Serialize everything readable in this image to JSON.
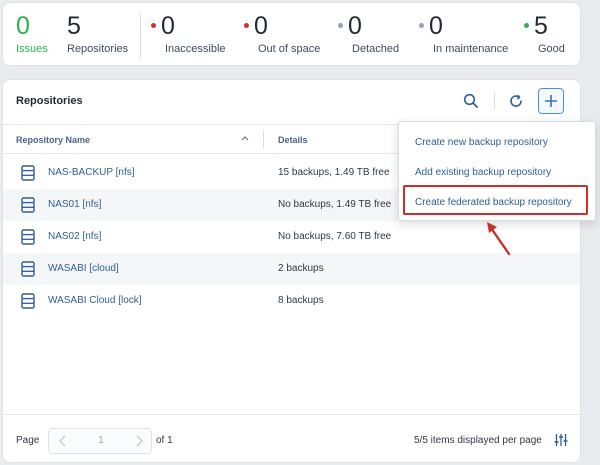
{
  "summary": {
    "issues": {
      "value": "0",
      "label": "Issues",
      "color": "#2bb24c"
    },
    "repositories": {
      "value": "5",
      "label": "Repositories"
    },
    "inaccessible": {
      "value": "0",
      "label": "Inaccessible",
      "dot_color": "#d32f2f"
    },
    "out_of_space": {
      "value": "0",
      "label": "Out of space",
      "dot_color": "#d32f2f"
    },
    "detached": {
      "value": "0",
      "label": "Detached",
      "dot_color": "#8fa3b8"
    },
    "maintenance": {
      "value": "0",
      "label": "In maintenance",
      "dot_color": "#8fa3b8"
    },
    "good": {
      "value": "5",
      "label": "Good",
      "dot_color": "#2bb24c"
    }
  },
  "panel": {
    "title": "Repositories",
    "search_icon": "search-icon",
    "refresh_icon": "refresh-icon",
    "add_icon": "plus-icon"
  },
  "table": {
    "columns": [
      "Repository Name",
      "Details"
    ],
    "rows": [
      {
        "name": "NAS-BACKUP [nfs]",
        "details": "15 backups, 1.49 TB free"
      },
      {
        "name": "NAS01 [nfs]",
        "details": "No backups, 1.49 TB free"
      },
      {
        "name": "NAS02 [nfs]",
        "details": "No backups, 7.60 TB free"
      },
      {
        "name": "WASABI [cloud]",
        "details": "2 backups"
      },
      {
        "name": "WASABI Cloud [lock]",
        "details": "8 backups"
      }
    ]
  },
  "footer": {
    "page_label": "Page",
    "page_number": "1",
    "of_label": "of 1",
    "per_page_label": "5/5 items displayed per page"
  },
  "menu": {
    "items": [
      "Create new backup repository",
      "Add existing backup repository",
      "Create federated backup repository"
    ],
    "highlight_color": "#c9302c"
  }
}
